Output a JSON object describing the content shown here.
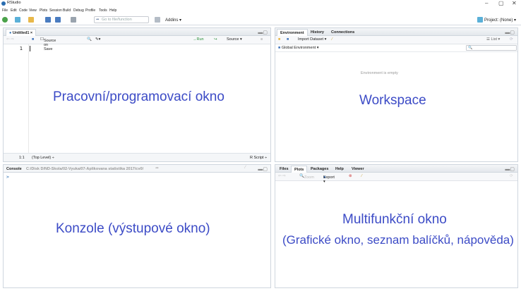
{
  "window": {
    "title": "RStudio",
    "minimize": "–",
    "maximize": "▢",
    "close": "✕"
  },
  "menu": [
    "File",
    "Edit",
    "Code",
    "View",
    "Plots",
    "Session",
    "Build",
    "Debug",
    "Profile",
    "Tools",
    "Help"
  ],
  "toolbar": {
    "goto_placeholder": "Go to file/function",
    "addins_label": "Addins ▾",
    "project_label": "Project: (None) ▾"
  },
  "source_pane": {
    "tab_label": "Untitled1 ×",
    "source_on_save": "Source on Save",
    "run_label": "→Run",
    "source_label": "Source ▾",
    "line_number": "1",
    "status_position": "1:1",
    "status_scope": "(Top Level) ÷",
    "status_type": "R Script ÷",
    "overlay_label": "Pracovní/programovací okno"
  },
  "console_pane": {
    "tab_label": "Console",
    "path": "C:/Disk D/ND-Skola/02-Vyuka/07-Aplikovana statistika 2017/cv0/",
    "prompt": ">",
    "overlay_label": "Konzole (výstupové okno)"
  },
  "environment_pane": {
    "tabs": [
      "Environment",
      "History",
      "Connections"
    ],
    "import_dataset": "Import Dataset ▾",
    "list_label": "☰ List ▾",
    "global_env": "Global Environment ▾",
    "empty_message": "Environment is empty",
    "overlay_label": "Workspace"
  },
  "files_pane": {
    "tabs": [
      "Files",
      "Plots",
      "Packages",
      "Help",
      "Viewer"
    ],
    "zoom_label": "Zoom",
    "export_label": "Export ▾",
    "overlay_label": "Multifunkční okno",
    "overlay_sublabel": "(Grafické okno, seznam balíčků, nápověda)"
  },
  "colors": {
    "accent": "#3c4bc6",
    "pane_border": "#cfd6de"
  }
}
